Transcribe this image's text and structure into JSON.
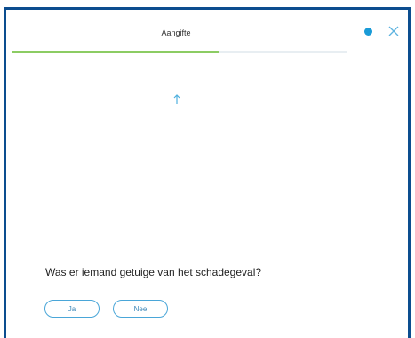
{
  "dialog": {
    "title": "Aangifte",
    "progress": 0.62
  },
  "question": {
    "text": "Was er iemand getuige van het schadegeval?"
  },
  "answers": {
    "yes_label": "Ja",
    "no_label": "Nee"
  },
  "icons": {
    "status": "status-dot-icon",
    "close": "close-icon",
    "arrow": "arrow-up-icon"
  },
  "colors": {
    "frame": "#0c4d8f",
    "accent": "#1a9bd7",
    "progress": "#8ccc63",
    "button_border": "#4aa6d8"
  }
}
